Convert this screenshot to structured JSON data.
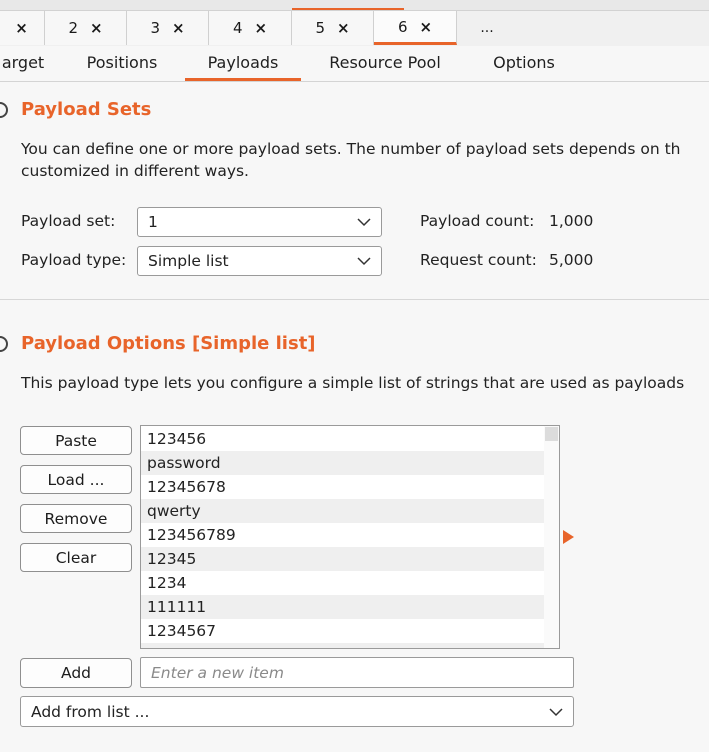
{
  "number_tabs": [
    {
      "label": "",
      "close": "×"
    },
    {
      "label": "2",
      "close": "×"
    },
    {
      "label": "3",
      "close": "×"
    },
    {
      "label": "4",
      "close": "×"
    },
    {
      "label": "5",
      "close": "×"
    },
    {
      "label": "6",
      "close": "×"
    },
    {
      "label": "...",
      "close": ""
    }
  ],
  "sub_tabs": [
    "arget",
    "Positions",
    "Payloads",
    "Resource Pool",
    "Options"
  ],
  "payload_sets": {
    "title": "Payload Sets",
    "description_line1": "You can define one or more payload sets. The number of payload sets depends on th",
    "description_line2": "customized in different ways.",
    "set_label": "Payload set:",
    "set_value": "1",
    "type_label": "Payload type:",
    "type_value": "Simple list",
    "count_label": "Payload count:",
    "count_value": "1,000",
    "request_label": "Request count:",
    "request_value": "5,000"
  },
  "payload_options": {
    "title": "Payload Options [Simple list]",
    "description": "This payload type lets you configure a simple list of strings that are used as payloads",
    "buttons": {
      "paste": "Paste",
      "load": "Load ...",
      "remove": "Remove",
      "clear": "Clear",
      "add": "Add"
    },
    "items": [
      "123456",
      "password",
      "12345678",
      "qwerty",
      "123456789",
      "12345",
      "1234",
      "111111",
      "1234567"
    ],
    "new_item_placeholder": "Enter a new item",
    "add_from_list": "Add from list ..."
  },
  "colors": {
    "accent": "#e8642a"
  }
}
